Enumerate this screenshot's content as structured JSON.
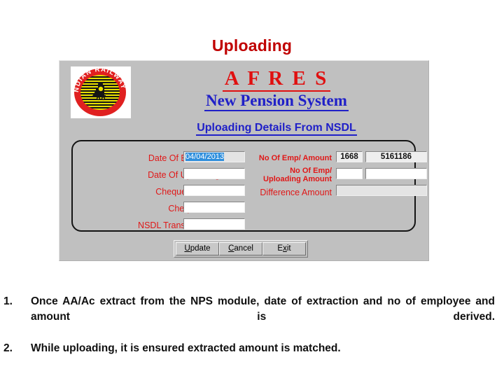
{
  "slide": {
    "title": "Uploading",
    "title_color": "#c00000"
  },
  "app": {
    "logo": {
      "name": "indian-railways-logo",
      "ring_text": "INDIAN RAILWAYS",
      "motto": "",
      "circle_color": "#e02020",
      "stripe_color": "#e8e000"
    },
    "heading_primary": "A F R E S",
    "heading_primary_color": "#e01010",
    "heading_secondary": "New Pension System",
    "heading_secondary_color": "#2020c8",
    "subheading": "Uploading Details From NSDL",
    "form": {
      "left_fields": [
        {
          "label": "Date Of Extraction",
          "value": "04/04/2013",
          "selected": true,
          "readonly": true
        },
        {
          "label": "Date Of Uploading",
          "value": "",
          "selected": false,
          "readonly": false
        },
        {
          "label": "Cheque Number",
          "value": "",
          "selected": false,
          "readonly": false
        },
        {
          "label": "Cheque Date",
          "value": "",
          "selected": false,
          "readonly": false
        },
        {
          "label": "NSDL Transaction ID",
          "value": "",
          "selected": false,
          "readonly": false
        }
      ],
      "right_fields": [
        {
          "label": "No Of Emp/ Amount",
          "label_line2": "",
          "count_value": "1668",
          "amount_value": "5161186",
          "readonly": true
        },
        {
          "label": "No Of Emp/",
          "label_line2": "Uploading Amount",
          "count_value": "",
          "amount_value": "",
          "readonly": false
        },
        {
          "label": "Difference Amount",
          "label_line2": "",
          "count_value": "",
          "amount_value": "",
          "readonly": true
        }
      ]
    },
    "buttons": [
      {
        "accel": "U",
        "rest": "pdate"
      },
      {
        "accel": "C",
        "rest": "ancel"
      },
      {
        "pre": "E",
        "accel": "x",
        "rest": "it"
      }
    ]
  },
  "notes": [
    {
      "number": "1.",
      "text": "Once AA/Ac extract from the NPS module, date of extraction and no of employee and amount is derived."
    },
    {
      "number": "2.",
      "text": "While uploading, it is ensured extracted amount is matched."
    }
  ]
}
